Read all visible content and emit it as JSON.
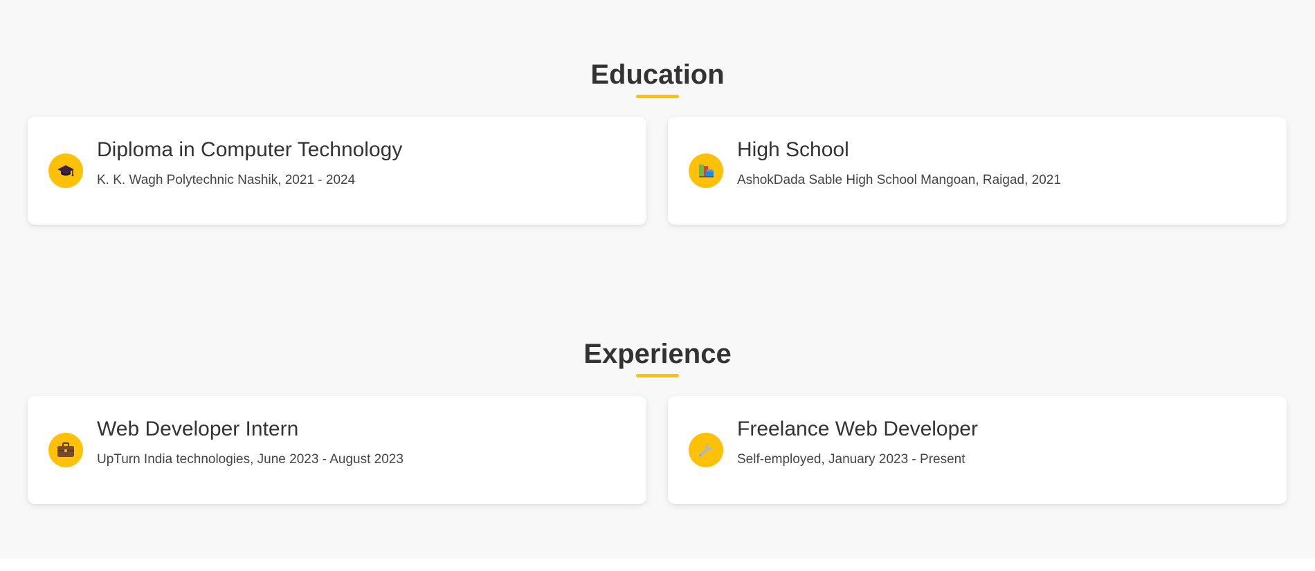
{
  "education": {
    "title": "Education",
    "items": [
      {
        "icon": "graduation-cap-icon",
        "title": "Diploma in Computer Technology",
        "subtitle": "K. K. Wagh Polytechnic Nashik, 2021 - 2024"
      },
      {
        "icon": "books-icon",
        "title": "High School",
        "subtitle": "AshokDada Sable High School Mangoan, Raigad, 2021"
      }
    ]
  },
  "experience": {
    "title": "Experience",
    "items": [
      {
        "icon": "briefcase-icon",
        "title": "Web Developer Intern",
        "subtitle": "UpTurn India technologies, June 2023 - August 2023"
      },
      {
        "icon": "wrench-icon",
        "title": "Freelance Web Developer",
        "subtitle": "Self-employed, January 2023 - Present"
      }
    ]
  },
  "colors": {
    "accent": "#ffc107",
    "background": "#f8f8f8",
    "card": "#ffffff",
    "text": "#333333"
  }
}
